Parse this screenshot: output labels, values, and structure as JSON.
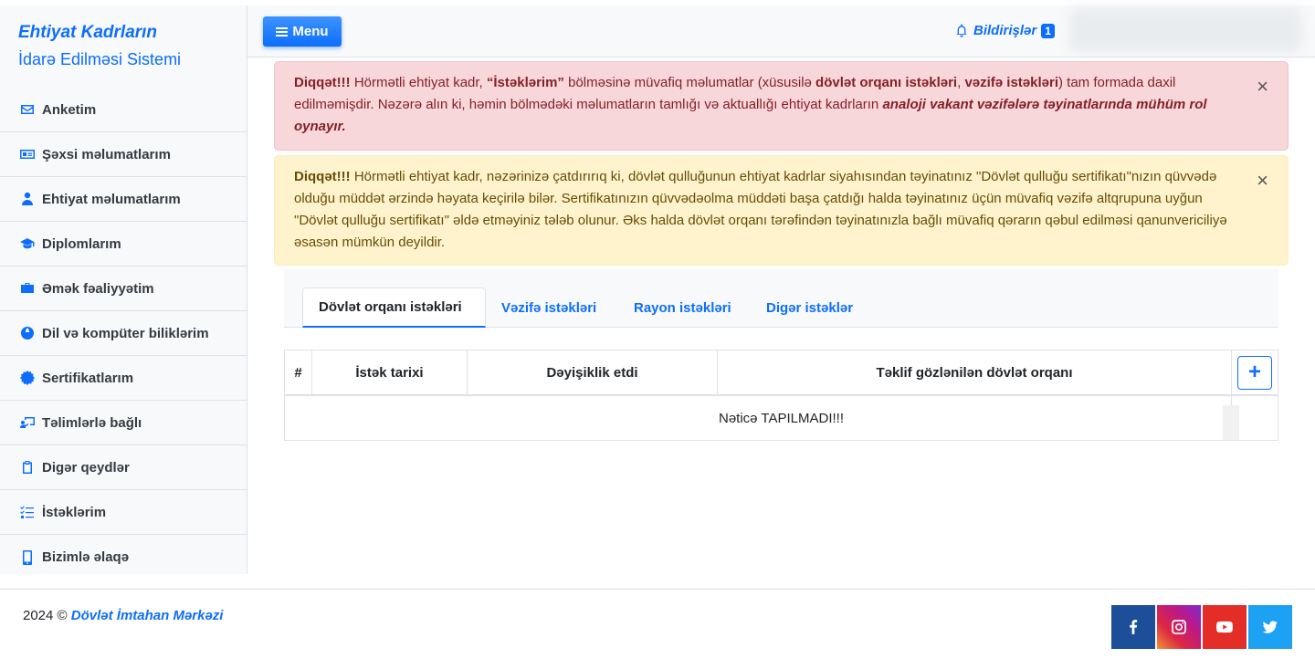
{
  "brand": {
    "title": "Ehtiyat Kadrların",
    "subtitle": "İdarə Edilməsi Sistemi"
  },
  "sidebar": {
    "items": [
      {
        "label": "Anketim",
        "icon": "envelope-icon"
      },
      {
        "label": "Şəxsi məlumatlarım",
        "icon": "id-card-icon"
      },
      {
        "label": "Ehtiyat məlumatlarım",
        "icon": "user-tie-icon"
      },
      {
        "label": "Diplomlarım",
        "icon": "graduation-cap-icon"
      },
      {
        "label": "Əmək fəaliyyətim",
        "icon": "briefcase-icon"
      },
      {
        "label": "Dil və kompüter biliklərim",
        "icon": "globe-icon"
      },
      {
        "label": "Sertifikatlarım",
        "icon": "certificate-icon"
      },
      {
        "label": "Təlimlərlə bağlı",
        "icon": "chalkboard-teacher-icon"
      },
      {
        "label": "Digər qeydlər",
        "icon": "clipboard-icon"
      },
      {
        "label": "İstəklərim",
        "icon": "tasks-icon"
      },
      {
        "label": "Bizimlə əlaqə",
        "icon": "mobile-icon"
      }
    ]
  },
  "topbar": {
    "menu_label": "Menu",
    "notifications_label": "Bildirişlər",
    "notifications_count": "1"
  },
  "alerts": {
    "danger": {
      "prefix": "Diqqət!!!",
      "t1": " Hörmətli ehtiyat kadr, ",
      "b1": "“İstəklərim”",
      "t2": " bölməsinə müvafiq məlumatlar (xüsusilə ",
      "b2": "dövlət orqanı istəkləri",
      "t3": ", ",
      "b3": "vəzifə istəkləri",
      "t4": ") tam formada daxil edilməmişdir. Nəzərə alın ki, həmin bölmədəki məlumatların tamlığı və aktuallığı ehtiyat kadrların ",
      "b4": "analoji vakant vəzifələrə təyinatlarında mühüm rol oynayır.",
      "close": "×"
    },
    "warning": {
      "prefix": "Diqqət!!!",
      "text": " Hörmətli ehtiyat kadr, nəzərinizə çatdırırıq ki, dövlət qulluğunun ehtiyat kadrlar siyahısından təyinatınız \"Dövlət qulluğu sertifikatı\"nızın qüvvədə olduğu müddət ərzində həyata keçirilə bilər. Sertifikatınızın qüvvədəolma müddəti başa çatdığı halda təyinatınız üçün müvafiq vəzifə altqrupuna uyğun \"Dövlət qulluğu sertifikatı\" əldə etməyiniz tələb olunur. Əks halda dövlət orqanı tərəfindən təyinatınızla bağlı müvafiq qərarın qəbul edilməsi qanunvericiliyə əsasən mümkün deyildir.",
      "close": "×"
    }
  },
  "tabs": [
    {
      "label": "Dövlət orqanı istəkləri",
      "active": true
    },
    {
      "label": "Vəzifə istəkləri",
      "active": false
    },
    {
      "label": "Rayon istəkləri",
      "active": false
    },
    {
      "label": "Digər istəklər",
      "active": false
    }
  ],
  "table": {
    "headers": [
      "#",
      "İstək tarixi",
      "Dəyişiklik etdi",
      "Təklif gözlənilən dövlət orqanı"
    ],
    "add_label": "+",
    "empty_text": "Nəticə TAPILMADI!!!"
  },
  "footer": {
    "year": "2024 ©",
    "org": "Dövlət İmtahan Mərkəzi",
    "social": [
      {
        "name": "facebook",
        "icon": "facebook-icon",
        "color": "#1d4e9a"
      },
      {
        "name": "instagram",
        "icon": "instagram-icon",
        "color": "#c13584"
      },
      {
        "name": "youtube",
        "icon": "youtube-icon",
        "color": "#e52d27"
      },
      {
        "name": "twitter",
        "icon": "twitter-icon",
        "color": "#1da1f2"
      }
    ]
  },
  "colors": {
    "accent": "#0d6efd",
    "danger_bg": "#f8d7da",
    "warning_bg": "#fff3cd"
  }
}
